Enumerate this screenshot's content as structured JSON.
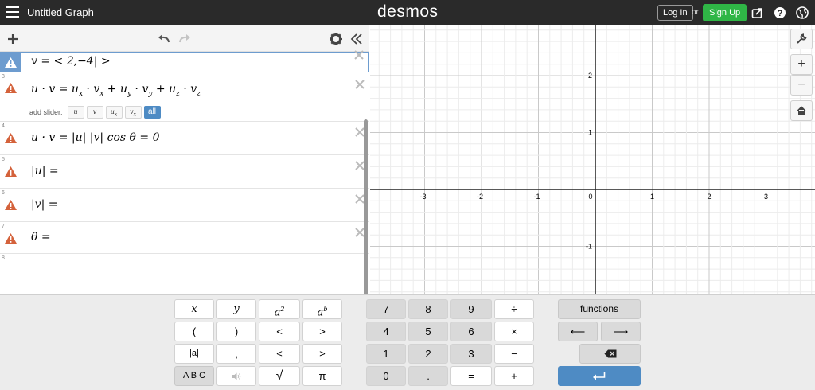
{
  "app": {
    "title": "Untitled Graph",
    "logo": "desmos",
    "login_label": "Log In",
    "or_label": "or",
    "signup_label": "Sign Up"
  },
  "expressions": [
    {
      "number": "",
      "latex": "v = < 2,−4| >",
      "active": true
    },
    {
      "number": "3",
      "latex": "u · v = u_x · v_x + u_y · v_y + u_z · v_z"
    },
    {
      "number": "4",
      "latex": "u · v = |u| |v| cos θ = 0"
    },
    {
      "number": "5",
      "latex": "|u| ="
    },
    {
      "number": "6",
      "latex": "|v| ="
    },
    {
      "number": "7",
      "latex": "θ ="
    },
    {
      "number": "8",
      "latex": ""
    }
  ],
  "slider": {
    "label": "add slider:",
    "options": [
      "u",
      "v",
      "u",
      "v",
      "all"
    ]
  },
  "graph": {
    "x_ticks": [
      "-3",
      "-2",
      "-1",
      "0",
      "1",
      "2",
      "3"
    ],
    "y_ticks": [
      "2",
      "1",
      "-1"
    ],
    "xlim": [
      -3.7,
      4.0
    ],
    "ylim": [
      -1.9,
      2.8
    ]
  },
  "keypad": {
    "left": [
      [
        "x",
        "y",
        "a2",
        "ab"
      ],
      [
        "(",
        ")",
        "<",
        ">"
      ],
      [
        "|a|",
        ",",
        "≤",
        "≥"
      ],
      [
        "A B C",
        "speaker",
        "√",
        "π"
      ]
    ],
    "numbers": [
      [
        "7",
        "8",
        "9",
        "÷"
      ],
      [
        "4",
        "5",
        "6",
        "×"
      ],
      [
        "1",
        "2",
        "3",
        "−"
      ],
      [
        "0",
        ".",
        "=",
        "+"
      ]
    ],
    "functions_label": "functions",
    "left_arrow": "⟵",
    "right_arrow": "⟶"
  }
}
